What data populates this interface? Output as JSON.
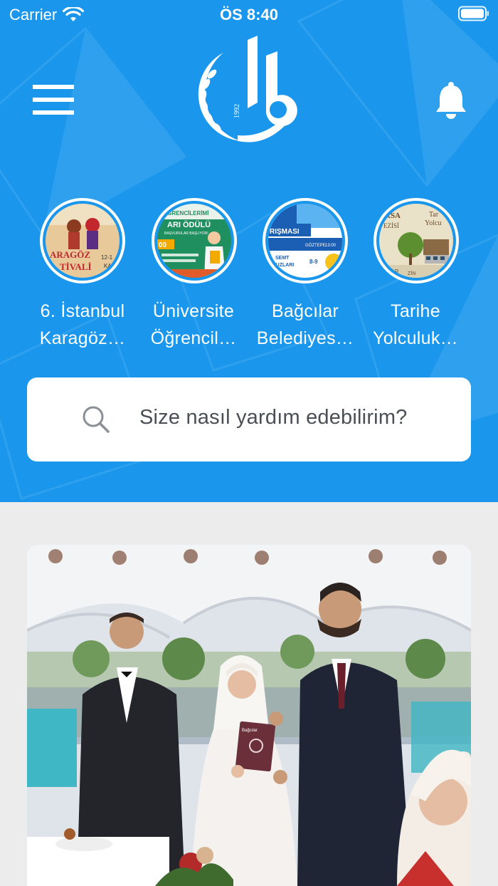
{
  "status_bar": {
    "carrier": "Carrier",
    "time": "ÖS 8:40",
    "wifi_icon": "wifi-icon",
    "battery_icon": "battery-icon"
  },
  "header": {
    "background_color": "#1a97ec",
    "menu_icon": "hamburger-menu-icon",
    "logo": {
      "name": "bagcilar-logo",
      "year_text": "1992"
    },
    "bell_icon": "bell-icon"
  },
  "stories": [
    {
      "title_line1": "6. İstanbul",
      "title_line2": "Karagöz…",
      "thumb_texts": [
        "ARAGÖZ",
        "TİVALİ",
        "12-1",
        "KA"
      ],
      "thumb_bg": "#e7c99a",
      "thumb_accent": "#c1272d"
    },
    {
      "title_line1": "Üniversite",
      "title_line2": "Öğrencil…",
      "thumb_texts": [
        "ÖĞRENCİLERİMİ",
        "ARI ÖDÜLÜ",
        "BAŞVURULAR BAŞLIYOR!",
        "00"
      ],
      "thumb_bg": "#1f8f5f",
      "thumb_accent": "#f2a900"
    },
    {
      "title_line1": "Bağcılar",
      "title_line2": "Belediyes…",
      "thumb_texts": [
        "E",
        "RIŞMASI",
        "GÖZTEPE",
        "SEMT",
        "YUZLARI",
        "13:00",
        "8-9"
      ],
      "thumb_bg": "#1b5fb4",
      "thumb_accent": "#f7c21b"
    },
    {
      "title_line1": "Tarihe",
      "title_line2": "Yolculuk…",
      "thumb_texts": [
        "RSA",
        "Tar",
        "Yolcu",
        "EZİSİ",
        "ULAR",
        "ZİN"
      ],
      "thumb_bg": "#e9e1c8",
      "thumb_accent": "#5b8f2f"
    }
  ],
  "search": {
    "placeholder": "Size nasıl yardım edebilirim?",
    "icon": "search-icon"
  },
  "news_card": {
    "image": "wedding-ceremony-photo",
    "book_text": "Bağcılar"
  }
}
